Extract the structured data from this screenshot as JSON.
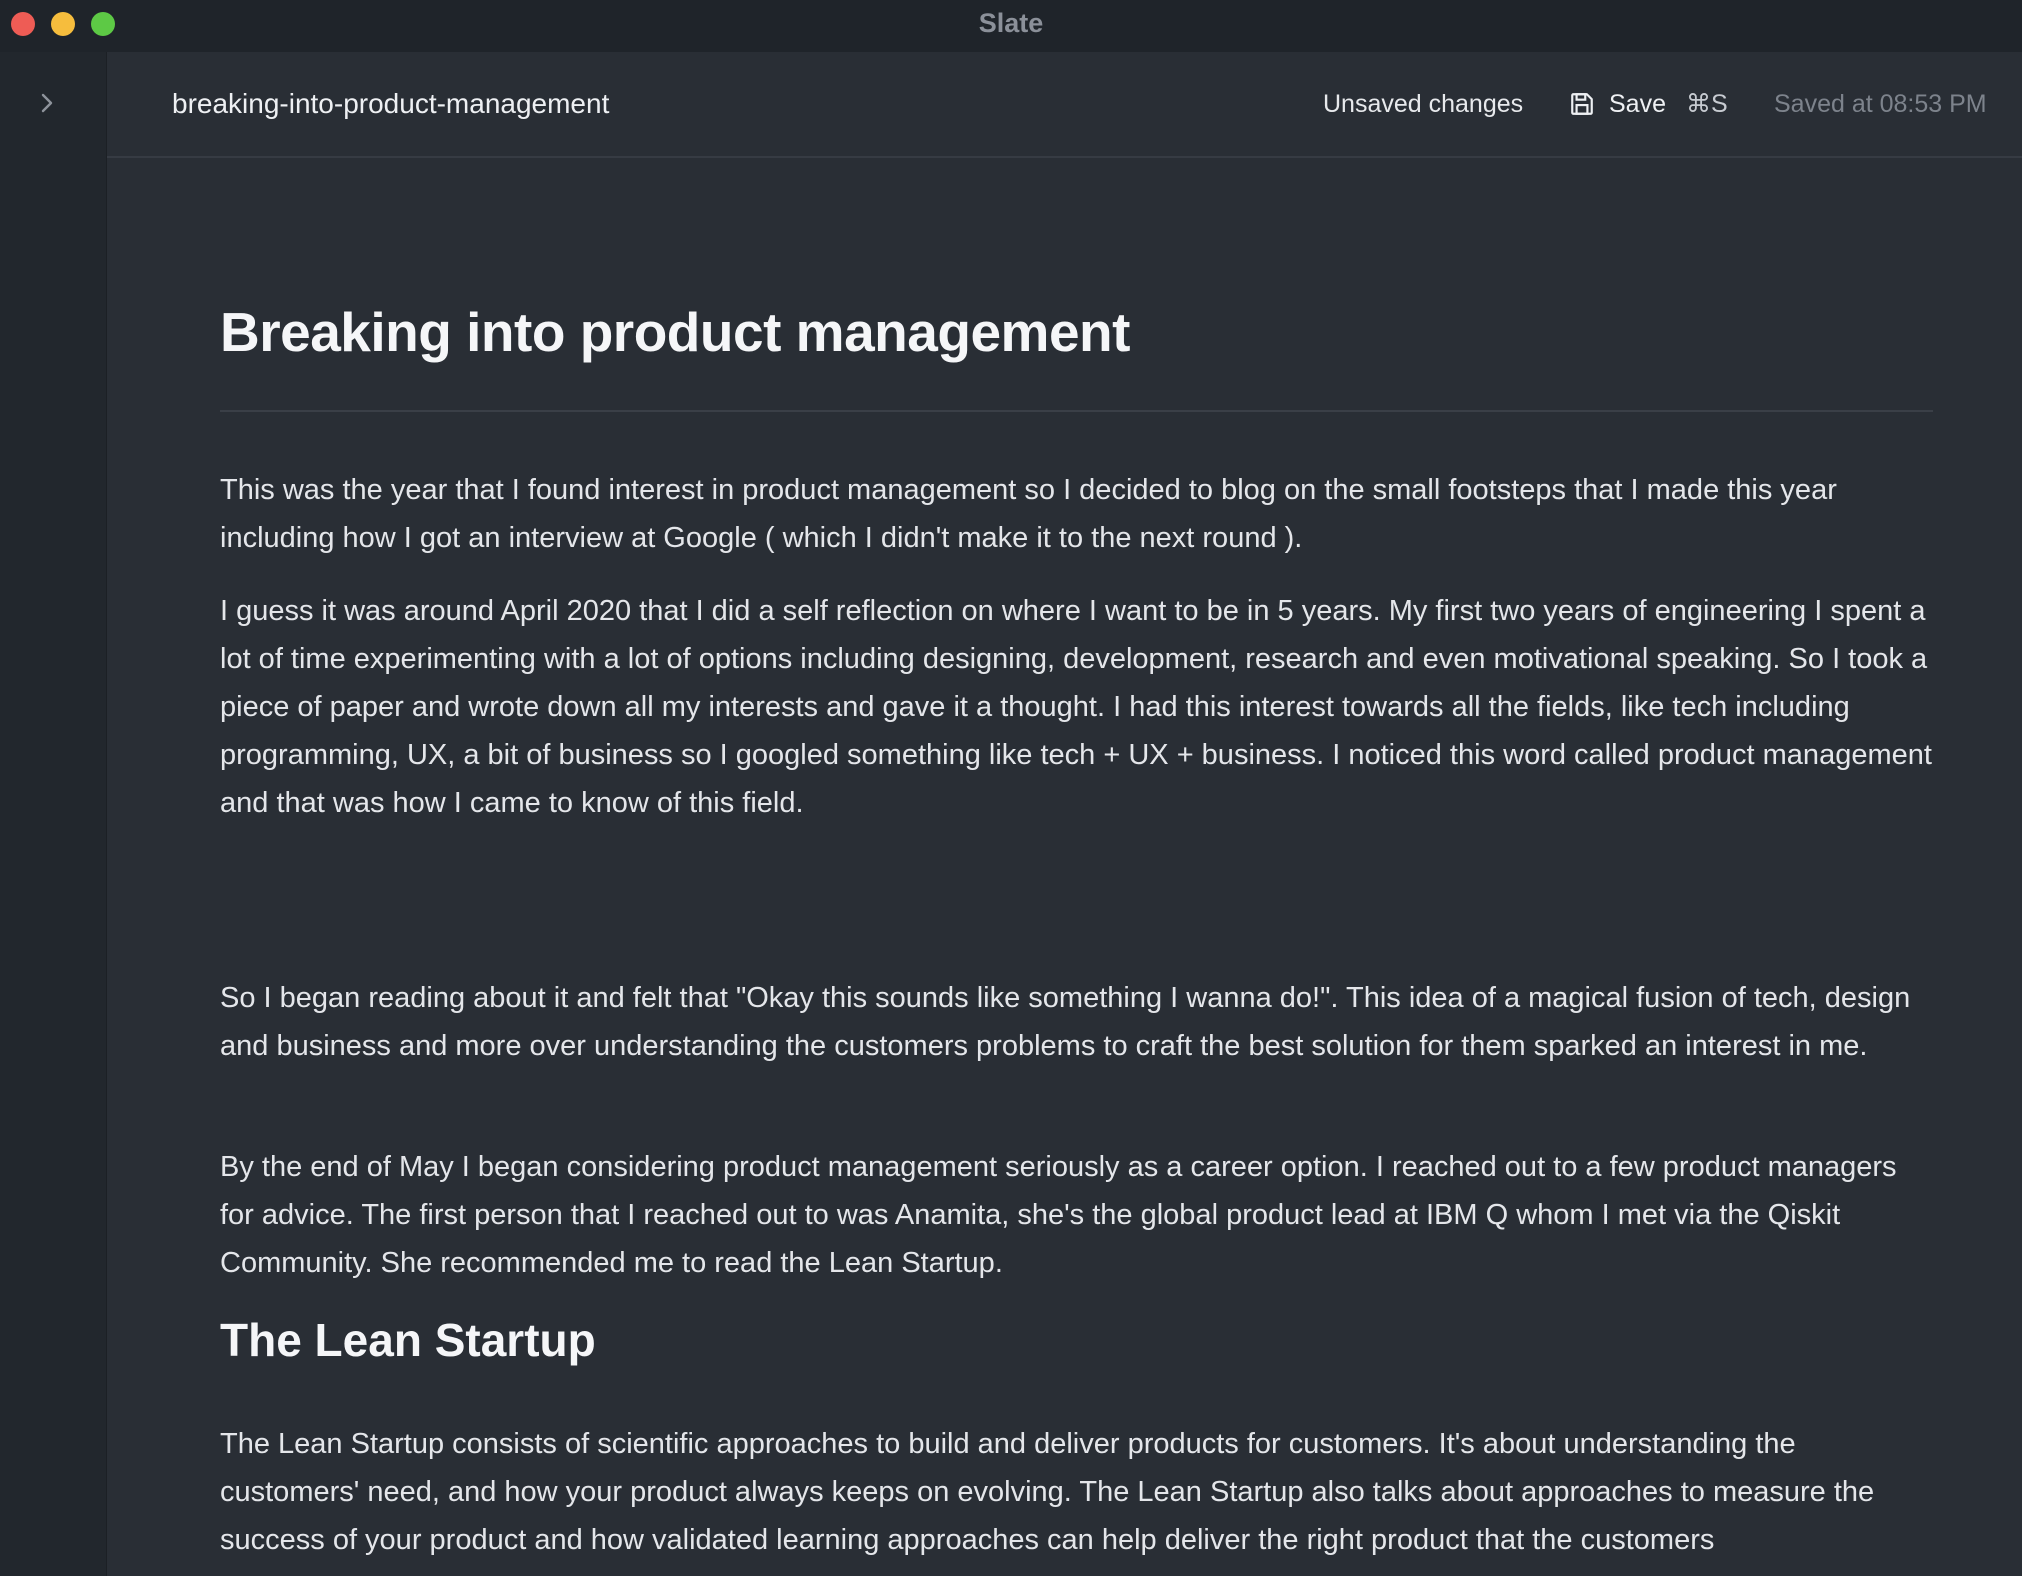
{
  "window": {
    "app_title": "Slate"
  },
  "toolbar": {
    "document_name": "breaking-into-product-management",
    "unsaved_status": "Unsaved changes",
    "save_label": "Save",
    "save_shortcut": "⌘S",
    "saved_at": "Saved at 08:53 PM"
  },
  "article": {
    "title": "Breaking into product management",
    "paragraphs": [
      "This was the year that I found interest in product management so I decided to blog on the small footsteps that I made this year including how I got an interview at Google ( which I didn't make it to the next round ).",
      "I guess it was around April 2020 that I did a self reflection on where I want to be in 5 years. My first two years of engineering I spent a lot of time experimenting with a lot of options including designing, development, research and even motivational speaking. So I took a piece of paper and wrote down all my interests and gave it a thought. I had this interest towards all the fields, like tech including programming, UX, a bit of business so I googled something like tech + UX + business. I noticed this word called product management and that was how I came to know of this field.",
      "So I began reading about it and felt that \"Okay this sounds like something I wanna do!\". This idea of a magical fusion of tech, design and business and more over understanding the customers problems to craft the best solution for them sparked an interest in me.",
      "By the end of May I began considering product management seriously as a career option. I reached out to a few product managers for advice. The first person that I reached out to was Anamita, she's the global product lead at IBM Q whom I met via the Qiskit Community. She recommended me to read the Lean Startup."
    ],
    "section_heading": "The Lean Startup",
    "section_paragraph": "The Lean Startup consists of scientific approaches to build and deliver products for customers. It's about understanding the customers' need, and how your product always keeps on evolving. The Lean Startup also talks about approaches to measure the success of your product and how validated learning approaches can help deliver the right product that the customers"
  },
  "icons": {
    "sidebar_toggle": "chevron-right-icon",
    "save": "floppy-disk-icon"
  },
  "colors": {
    "background": "#292e35",
    "sidebar": "#22272d",
    "titlebar": "#1f242a",
    "text": "#e4e6ea",
    "muted_text": "#7d838c",
    "close": "#ee5c55",
    "minimize": "#f6bd3d",
    "maximize": "#5dc945"
  }
}
